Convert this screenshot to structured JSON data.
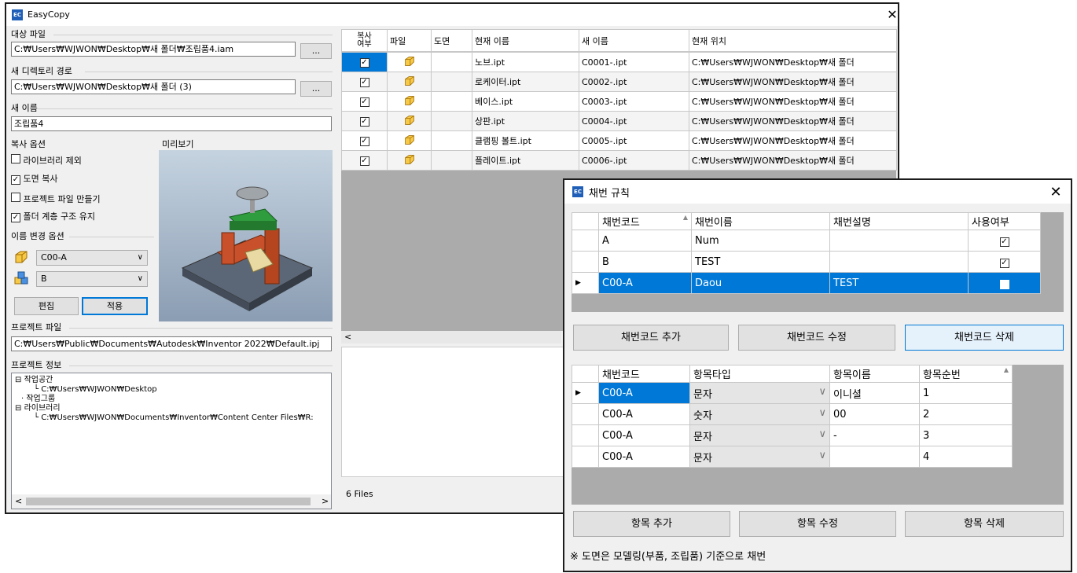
{
  "main_window": {
    "title": "EasyCopy",
    "icon_text": "EC",
    "target_file": {
      "label": "대상 파일",
      "value": "C:₩Users₩WJWON₩Desktop₩새 폴더₩조립품4.iam",
      "browse": "..."
    },
    "new_dir": {
      "label": "새 디렉토리 경로",
      "value": "C:₩Users₩WJWON₩Desktop₩새 폴더 (3)",
      "browse": "..."
    },
    "new_name": {
      "label": "새 이름",
      "value": "조립품4"
    },
    "copy_options": {
      "label": "복사 옵션",
      "items": [
        {
          "label": "라이브러리 제외",
          "checked": false,
          "mark": ""
        },
        {
          "label": "도면 복사",
          "checked": true,
          "mark": "✓"
        },
        {
          "label": "프로젝트 파일 만들기",
          "checked": false,
          "mark": ""
        },
        {
          "label": "폴더 계층 구조 유지",
          "checked": true,
          "mark": "✓"
        }
      ]
    },
    "preview": {
      "label": "미리보기"
    },
    "rename_options": {
      "label": "이름 변경 옵션",
      "combo1": "C00-A",
      "combo2": "B",
      "edit_button": "편집",
      "apply_button": "적용"
    },
    "project_file": {
      "label": "프로젝트 파일",
      "value": "C:₩Users₩Public₩Documents₩Autodesk₩Inventor 2022₩Default.ipj"
    },
    "project_info": {
      "label": "프로젝트 정보",
      "tree": [
        {
          "text": "작업공간"
        },
        {
          "text": "C:₩Users₩WJWON₩Desktop"
        },
        {
          "text": "작업그룹"
        },
        {
          "text": "라이브러리"
        },
        {
          "text": "C:₩Users₩WJWON₩Documents₩Inventor₩Content Center Files₩R:"
        }
      ],
      "collapse_glyph": "⊟"
    },
    "grid": {
      "headers": [
        "복사\n여부",
        "파일",
        "도면",
        "현재 이름",
        "새 이름",
        "현재 위치"
      ],
      "rows": [
        {
          "current": "노브.ipt",
          "new": "C0001-.ipt",
          "location": "C:₩Users₩WJWON₩Desktop₩새 폴더"
        },
        {
          "current": "로케이터.ipt",
          "new": "C0002-.ipt",
          "location": "C:₩Users₩WJWON₩Desktop₩새 폴더"
        },
        {
          "current": "베이스.ipt",
          "new": "C0003-.ipt",
          "location": "C:₩Users₩WJWON₩Desktop₩새 폴더"
        },
        {
          "current": "상판.ipt",
          "new": "C0004-.ipt",
          "location": "C:₩Users₩WJWON₩Desktop₩새 폴더"
        },
        {
          "current": "클램핑 볼트.ipt",
          "new": "C0005-.ipt",
          "location": "C:₩Users₩WJWON₩Desktop₩새 폴더"
        },
        {
          "current": "플레이트.ipt",
          "new": "C0006-.ipt",
          "location": "C:₩Users₩WJWON₩Desktop₩새 폴더"
        }
      ],
      "check_mark": "✓"
    },
    "status": "6 Files",
    "scroll_left": "<",
    "scroll_right": ">",
    "close": "✕"
  },
  "dialog": {
    "title": "채번 규칙",
    "icon_text": "EC",
    "close": "✕",
    "rule_grid": {
      "headers": [
        "채번코드",
        "채번이름",
        "채번설명",
        "사용여부"
      ],
      "sort_glyph": "▲",
      "rows": [
        {
          "code": "A",
          "name": "Num",
          "desc": "",
          "use": "✓"
        },
        {
          "code": "B",
          "name": "TEST",
          "desc": "",
          "use": "✓"
        },
        {
          "code": "C00-A",
          "name": "Daou",
          "desc": "TEST",
          "use": "✓"
        }
      ],
      "row_pointer": "▶"
    },
    "buttons1": [
      "채번코드 추가",
      "채번코드 수정",
      "채번코드 삭제"
    ],
    "item_grid": {
      "headers": [
        "채번코드",
        "항목타입",
        "항목이름",
        "항목순번"
      ],
      "sort_glyph": "▲",
      "rows": [
        {
          "code": "C00-A",
          "type": "문자",
          "name": "이니셜",
          "order": "1"
        },
        {
          "code": "C00-A",
          "type": "숫자",
          "name": "00",
          "order": "2"
        },
        {
          "code": "C00-A",
          "type": "문자",
          "name": "-",
          "order": "3"
        },
        {
          "code": "C00-A",
          "type": "문자",
          "name": "",
          "order": "4"
        }
      ],
      "dropdown_glyph": "∨"
    },
    "buttons2": [
      "항목 추가",
      "항목 수정",
      "항목 삭제"
    ],
    "note": "※ 도면은 모델링(부품, 조립품) 기준으로 채번"
  }
}
